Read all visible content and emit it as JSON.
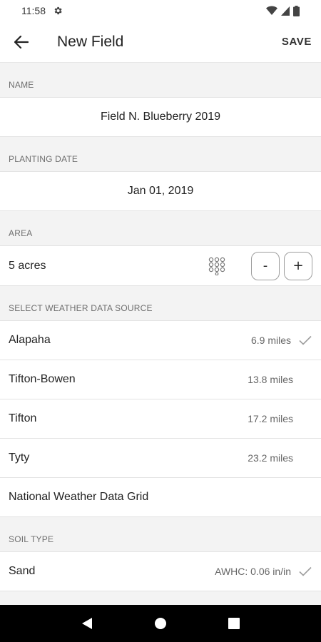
{
  "status_bar": {
    "time": "11:58"
  },
  "app_bar": {
    "title": "New Field",
    "save_label": "SAVE"
  },
  "name_section": {
    "header": "NAME",
    "value": "Field N. Blueberry 2019"
  },
  "planting_section": {
    "header": "PLANTING DATE",
    "value": "Jan 01, 2019"
  },
  "area_section": {
    "header": "AREA",
    "value": "5 acres",
    "minus_label": "-",
    "plus_label": "+"
  },
  "weather_section": {
    "header": "SELECT WEATHER DATA SOURCE",
    "items": [
      {
        "name": "Alapaha",
        "distance": "6.9 miles",
        "selected": true
      },
      {
        "name": "Tifton-Bowen",
        "distance": "13.8 miles",
        "selected": false
      },
      {
        "name": "Tifton",
        "distance": "17.2 miles",
        "selected": false
      },
      {
        "name": "Tyty",
        "distance": "23.2 miles",
        "selected": false
      },
      {
        "name": "National Weather Data Grid",
        "distance": "",
        "selected": false
      }
    ]
  },
  "soil_section": {
    "header": "SOIL TYPE",
    "items": [
      {
        "name": "Sand",
        "detail": "AWHC: 0.06 in/in",
        "selected": true
      }
    ]
  },
  "colors": {
    "background": "#f3f3f3",
    "surface": "#ffffff",
    "nav_bar": "#000000",
    "muted_text": "#6f6f6f",
    "check": "#9e9e9e"
  },
  "icons": [
    "gear-icon",
    "wifi-icon",
    "signal-icon",
    "battery-icon",
    "back-arrow-icon",
    "grid-icon",
    "check-icon",
    "nav-back-icon",
    "nav-home-icon",
    "nav-recents-icon"
  ]
}
